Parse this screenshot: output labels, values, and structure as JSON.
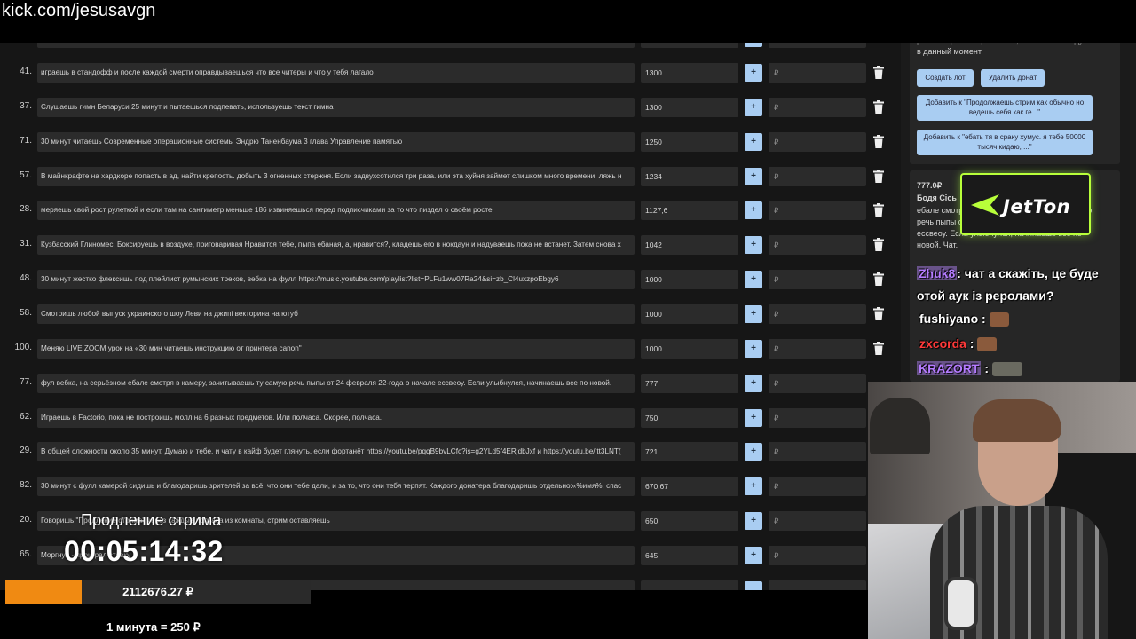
{
  "browser": {
    "url": "kick.com/jesusavgn"
  },
  "rows": [
    {
      "num": "41.",
      "text": "играешь в стандофф и после каждой смерти оправдываешься что все читеры и что у тебя лагало",
      "amount": "1300",
      "rub": "₽"
    },
    {
      "num": "37.",
      "text": "Слушаешь гимн Беларуси 25 минут и пытаешься подпевать, используешь текст гимна",
      "amount": "1300",
      "rub": "₽"
    },
    {
      "num": "71.",
      "text": "30 минут читаешь Современные операционные системы Эндрю Таненбаума 3 глава Управление памятью",
      "amount": "1250",
      "rub": "₽"
    },
    {
      "num": "57.",
      "text": "В майнкрафте на хардкоре попасть в ад, найти крепость. добыть 3 огненных стержня. Если задвухсотился три раза. или эта хуйня займет слишком много времени, ляжь н",
      "amount": "1234",
      "rub": "₽"
    },
    {
      "num": "28.",
      "text": "меряешь свой рост рулеткой и если там на сантиметр меньше 186 извиняешься перед подписчиками за то что пиздел о своём росте",
      "amount": "1127,6",
      "rub": "₽"
    },
    {
      "num": "31.",
      "text": "Кузбасский Глиномес. Боксируешь в воздухе, приговаривая Нравится тебе, пыпа ебаная, а, нравится?, кладешь его в нокдаун и надуваешь пока не встанет. Затем снова х",
      "amount": "1042",
      "rub": "₽"
    },
    {
      "num": "48.",
      "text": "30 минут жестко флексишь под плейлист румынских треков, вебка на фулл https://music.youtube.com/playlist?list=PLFu1ww07Ra24&si=zb_Cl4uxzpoEbgy6",
      "amount": "1000",
      "rub": "₽"
    },
    {
      "num": "58.",
      "text": "Смотришь любой выпуск украинского шоу Леви на джипі векторина на ютуб",
      "amount": "1000",
      "rub": "₽"
    },
    {
      "num": "100.",
      "text": "Меняю LIVE ZOOM урок на «30 мин читаешь инструкцию от принтера canon\"",
      "amount": "1000",
      "rub": "₽"
    },
    {
      "num": "77.",
      "text": "фул вебка, на серьёзном ебале смотря в камеру, зачитываешь ту самую речь пыпы от 24 февраля 22-года о начале есcвеоу. Если улыбнулся, начинаешь все по новой.",
      "amount": "777",
      "rub": "₽"
    },
    {
      "num": "62.",
      "text": "Играешь в Factorio, пока не построишь молл на 6 разных предметов. Или полчаса. Скорее, полчаса.",
      "amount": "750",
      "rub": "₽"
    },
    {
      "num": "29.",
      "text": "В общей сложности около 35 минут. Думаю и тебе, и чату в кайф будет глянуть, если фортанёт https://youtu.be/pqqB9bvLCfc?is=g2YLd5f4ERjdbJxf и https://youtu.be/ltt3LNT(",
      "amount": "721",
      "rub": "₽"
    },
    {
      "num": "82.",
      "text": "30 минут с фулл камерой сидишь и благодаришь зрителей за всё, что они тебе дали, и за то, что они тебя терпят. Каждого донатера благодаришь отдельно:«%имя%, спас",
      "amount": "670,67",
      "rub": "₽"
    },
    {
      "num": "20.",
      "text": "Говоришь \"Продление стрима\" через каждые полчаса из комнаты, стрим оставляешь",
      "amount": "650",
      "rub": "₽"
    },
    {
      "num": "65.",
      "text": "Моргнул - проиграл ставку",
      "amount": "645",
      "rub": "₽"
    }
  ],
  "panel": {
    "card1_text_1": "репетитор на вопрос о том, что ты сейчас думаешь",
    "card1_text_2": "в данный момент",
    "create_lot": "Создать лот",
    "delete_donat": "Удалить донат",
    "add_to_1": "Добавить к \"Продолжаешь стрим как обычно но ведешь себя как ге...\"",
    "add_to_2": "Добавить к \"ебать тя в сраку хумус. я тебе 50000 тысяч кидаю, ...\"",
    "donation_amount": "777.0₽",
    "donation_name": "Бодя Сісь",
    "donation_text": "ебале смотря в камеру, зачитываешь ту самую речь пыпы от 24 февраля 22-года о начале есcвеоу. Если улыбнулся, начинаешь все по новой. Чат."
  },
  "jetton": {
    "label": "JetTon"
  },
  "chat": [
    {
      "user": "Zhuk8",
      "message": ": чат а скажіть, це буде"
    },
    {
      "user": "",
      "message": "отой аук із реролами?"
    },
    {
      "user": "fushiyano",
      "message": " :"
    },
    {
      "user": "zxcorda",
      "message": " :"
    },
    {
      "user": "KRAZORT",
      "message": " :"
    }
  ],
  "overlay": {
    "title": "Продление стрима",
    "timer": "00:05:14:32",
    "total": "2112676.27 ₽",
    "rate": "1 минута = 250 ₽",
    "progress_fraction": 0.25
  },
  "colors": {
    "accent_button": "#a9cdf2",
    "progress": "#f08a12",
    "jetton_border": "#b8ff3a"
  }
}
